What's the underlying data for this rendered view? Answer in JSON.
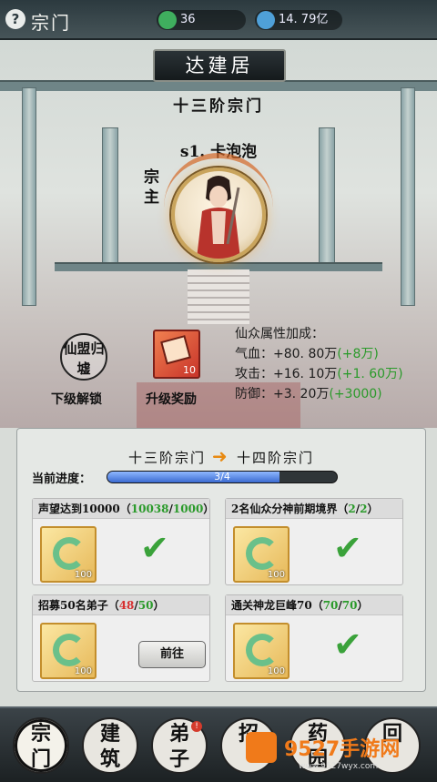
{
  "topbar": {
    "help": "?",
    "title": "宗门",
    "resource_a": "36",
    "resource_b": "14. 79亿",
    "resource_a_icon": "jade-plus-icon",
    "resource_b_icon": "spirit-drop-icon"
  },
  "hall": {
    "name": "达建居",
    "rank": "十三阶宗门",
    "leader_name": "s1. 卡泡泡",
    "leader_label": "宗主"
  },
  "unlock": {
    "seal_text": "仙盟归墟",
    "caption": "下级解锁"
  },
  "reward": {
    "count": "10",
    "caption": "升级奖励"
  },
  "attributes": {
    "title": "仙众属性加成：",
    "rows": [
      {
        "label": "气血：+80. 80万",
        "bonus": "(+8万)"
      },
      {
        "label": "攻击：+16. 10万",
        "bonus": "(+1. 60万)"
      },
      {
        "label": "防御：+3. 20万",
        "bonus": "(+3000)"
      }
    ]
  },
  "upgrade": {
    "from": "十三阶宗门",
    "to": "十四阶宗门",
    "progress_label": "当前进度：",
    "progress_text": "3/4",
    "progress_value": 0.75
  },
  "tasks": [
    {
      "title": "声望达到10000（",
      "current": "10038",
      "sep": "/",
      "total": "1000",
      "close": "）",
      "qty": "100",
      "done": true
    },
    {
      "title": "2名仙众分神前期境界（",
      "current": "2",
      "sep": "/",
      "total": "2",
      "close": "）",
      "qty": "100",
      "done": true
    },
    {
      "title": "招募50名弟子（",
      "current": "48",
      "sep": "/",
      "total": "50",
      "close": "）",
      "qty": "100",
      "done": false,
      "button": "前往"
    },
    {
      "title": "通关神龙巨峰70（",
      "current": "70",
      "sep": "/",
      "total": "70",
      "close": "）",
      "qty": "100",
      "done": true
    }
  ],
  "check_mark": "✔",
  "nav": [
    {
      "line1": "宗",
      "line2": "门",
      "active": true,
      "badge": ""
    },
    {
      "line1": "建",
      "line2": "筑",
      "active": false,
      "badge": ""
    },
    {
      "line1": "弟",
      "line2": "子",
      "active": false,
      "badge": "!"
    },
    {
      "line1": "招",
      "line2": "",
      "active": false,
      "badge": ""
    },
    {
      "line1": "药",
      "line2": "园",
      "active": false,
      "badge": ""
    },
    {
      "line1": "",
      "line2": "回",
      "active": false,
      "badge": ""
    }
  ],
  "watermark": {
    "brand": "9527手游网",
    "url": "www.9527wyx.com"
  },
  "colors": {
    "accent_green": "#2a9a2a",
    "accent_red": "#d63030",
    "arrow": "#e88a12"
  }
}
